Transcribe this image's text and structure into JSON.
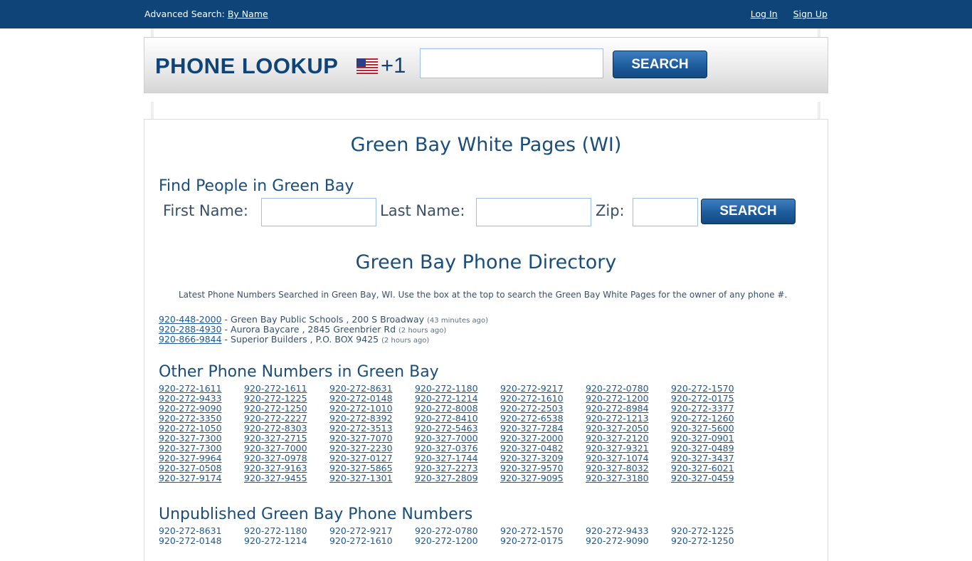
{
  "topbar": {
    "advanced_label": "Advanced Search:",
    "by_name_link": "By Name",
    "login_link": "Log In",
    "signup_link": "Sign Up"
  },
  "lookup": {
    "title": "PHONE LOOKUP",
    "flag_icon": "us-flag-icon",
    "country_code": "+1",
    "phone_input_value": "",
    "search_button": "SEARCH"
  },
  "page": {
    "heading": "Green Bay White Pages (WI)",
    "find_heading": "Find People in Green Bay",
    "first_name_label": "First Name:",
    "last_name_label": "Last Name:",
    "zip_label": "Zip:",
    "search_button": "SEARCH",
    "directory_heading": "Green Bay Phone Directory",
    "intro_text": "Latest Phone Numbers Searched in Green Bay, WI. Use the box at the top to search the Green Bay White Pages for the owner of any phone #."
  },
  "latest": [
    {
      "number": "920-448-2000",
      "desc": " - Green Bay Public Schools , 200 S Broadway ",
      "ago": "(43 minutes ago)"
    },
    {
      "number": "920-288-4930",
      "desc": " - Aurora Baycare , 2845 Greenbrier Rd ",
      "ago": "(2 hours ago)"
    },
    {
      "number": "920-866-9844",
      "desc": " - Superior Builders , P.O. BOX 9425 ",
      "ago": "(2 hours ago)"
    }
  ],
  "other": {
    "heading": "Other Phone Numbers in Green Bay",
    "numbers": [
      "920-272-1611",
      "920-272-1611",
      "920-272-8631",
      "920-272-1180",
      "920-272-9217",
      "920-272-0780",
      "920-272-1570",
      "920-272-9433",
      "920-272-1225",
      "920-272-0148",
      "920-272-1214",
      "920-272-1610",
      "920-272-1200",
      "920-272-0175",
      "920-272-9090",
      "920-272-1250",
      "920-272-1010",
      "920-272-8008",
      "920-272-2503",
      "920-272-8984",
      "920-272-3377",
      "920-272-3350",
      "920-272-2227",
      "920-272-8392",
      "920-272-8410",
      "920-272-6538",
      "920-272-1213",
      "920-272-1260",
      "920-272-1050",
      "920-272-8303",
      "920-272-3513",
      "920-272-5463",
      "920-327-7284",
      "920-327-2050",
      "920-327-5600",
      "920-327-7300",
      "920-327-2715",
      "920-327-7070",
      "920-327-7000",
      "920-327-2000",
      "920-327-2120",
      "920-327-0901",
      "920-327-7300",
      "920-327-7000",
      "920-327-2230",
      "920-327-0376",
      "920-327-0482",
      "920-327-9321",
      "920-327-0489",
      "920-327-9964",
      "920-327-0978",
      "920-327-0127",
      "920-327-1744",
      "920-327-3209",
      "920-327-1074",
      "920-327-3437",
      "920-327-0508",
      "920-327-9163",
      "920-327-5865",
      "920-327-2273",
      "920-327-9570",
      "920-327-8032",
      "920-327-6021",
      "920-327-9174",
      "920-327-9455",
      "920-327-1301",
      "920-327-2809",
      "920-327-9095",
      "920-327-3180",
      "920-327-0459"
    ]
  },
  "unpublished": {
    "heading": "Unpublished Green Bay Phone Numbers",
    "numbers": [
      "920-272-8631",
      "920-272-1180",
      "920-272-9217",
      "920-272-0780",
      "920-272-1570",
      "920-272-9433",
      "920-272-1225",
      "920-272-0148",
      "920-272-1214",
      "920-272-1610",
      "920-272-1200",
      "920-272-0175",
      "920-272-9090",
      "920-272-1250"
    ]
  }
}
